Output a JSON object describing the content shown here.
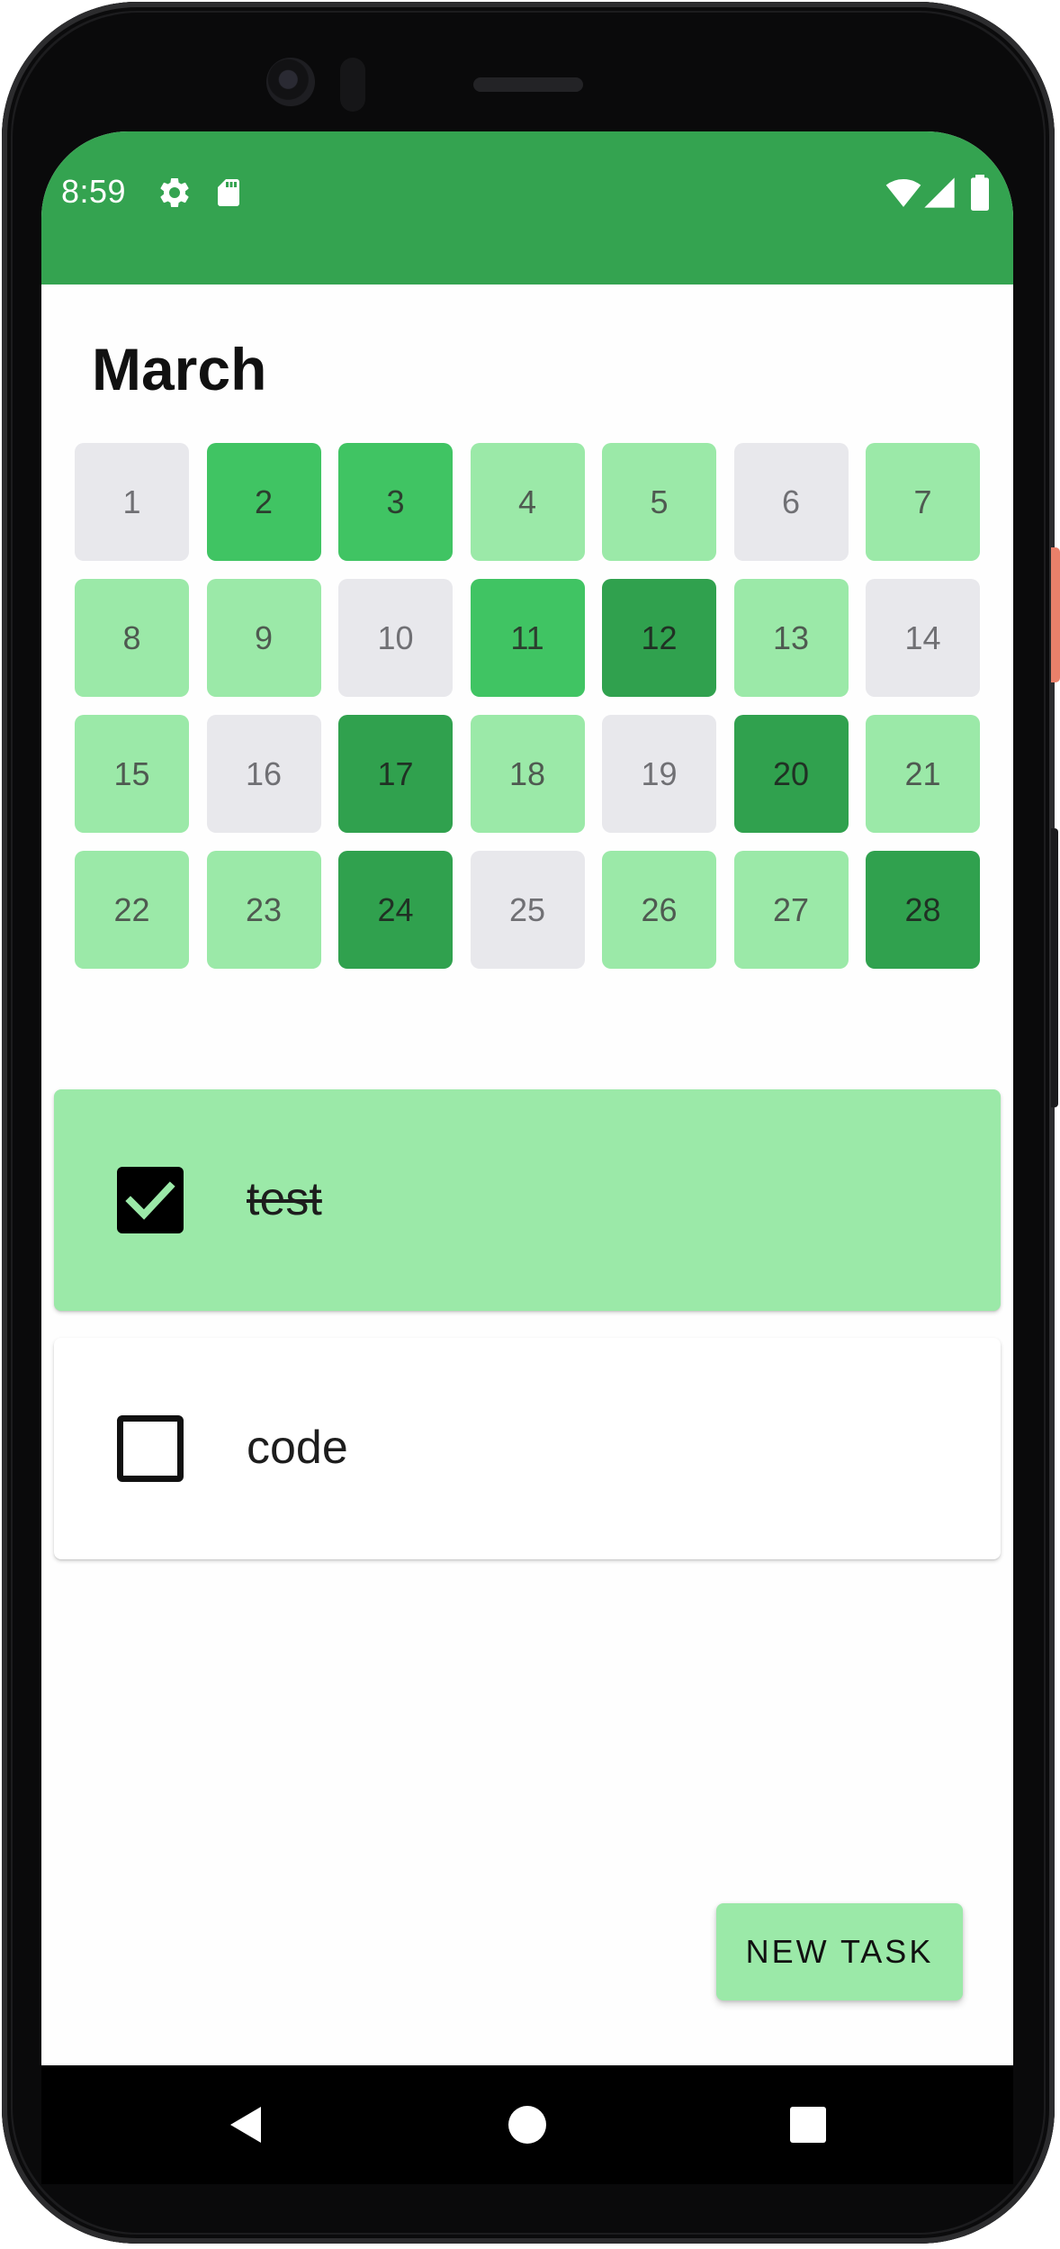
{
  "status_bar": {
    "time": "8:59",
    "color": "#34A350",
    "icons": [
      "settings-gear-icon",
      "sd-card-icon",
      "wifi-icon",
      "cell-signal-icon",
      "battery-icon"
    ]
  },
  "calendar": {
    "month": "March",
    "level_colors": [
      "#E8E8EC",
      "#9BE9A8",
      "#40C463",
      "#30A14E"
    ],
    "days": [
      {
        "label": "1",
        "level": 0
      },
      {
        "label": "2",
        "level": 2
      },
      {
        "label": "3",
        "level": 2
      },
      {
        "label": "4",
        "level": 1
      },
      {
        "label": "5",
        "level": 1
      },
      {
        "label": "6",
        "level": 0
      },
      {
        "label": "7",
        "level": 1
      },
      {
        "label": "8",
        "level": 1
      },
      {
        "label": "9",
        "level": 1
      },
      {
        "label": "10",
        "level": 0
      },
      {
        "label": "11",
        "level": 2
      },
      {
        "label": "12",
        "level": 3
      },
      {
        "label": "13",
        "level": 1
      },
      {
        "label": "14",
        "level": 0
      },
      {
        "label": "15",
        "level": 1
      },
      {
        "label": "16",
        "level": 0
      },
      {
        "label": "17",
        "level": 3
      },
      {
        "label": "18",
        "level": 1
      },
      {
        "label": "19",
        "level": 0
      },
      {
        "label": "20",
        "level": 3
      },
      {
        "label": "21",
        "level": 1
      },
      {
        "label": "22",
        "level": 1
      },
      {
        "label": "23",
        "level": 1
      },
      {
        "label": "24",
        "level": 3
      },
      {
        "label": "25",
        "level": 0
      },
      {
        "label": "26",
        "level": 1
      },
      {
        "label": "27",
        "level": 1
      },
      {
        "label": "28",
        "level": 3
      }
    ]
  },
  "tasks": [
    {
      "label": "test",
      "checked": true
    },
    {
      "label": "code",
      "checked": false
    }
  ],
  "actions": {
    "new_task_label": "NEW TASK"
  },
  "navigation": {
    "buttons": [
      "back-icon",
      "home-icon",
      "recents-icon"
    ]
  }
}
